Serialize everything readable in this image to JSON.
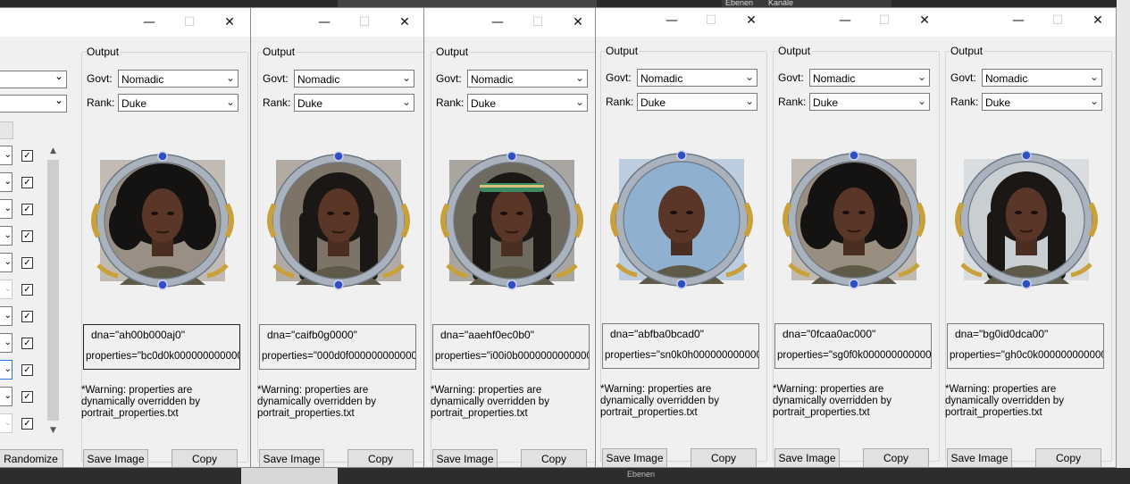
{
  "background": {
    "strip_labels": [
      "Ebenen",
      "Kanäle"
    ],
    "bottom_label": "Ebenen"
  },
  "window_controls": {
    "minimize": "—",
    "maximize": "☐",
    "close": "✕"
  },
  "left_window": {
    "randomize_label": "Randomize",
    "scroll_up": "▲",
    "scroll_down": "▼",
    "checkmark": "✓",
    "chevron": "⌄"
  },
  "icons": {
    "dropdown_arrow": "chevron-down-icon"
  },
  "colors": {
    "window_bg": "#f0f0f0",
    "titlebar_bg": "#ffffff",
    "taskbar": "#2b2b2b",
    "frame_silver": "#aab3bd",
    "frame_gold": "#c9a13a",
    "gem_blue": "#2e4fc4"
  },
  "panels": [
    {
      "group_label": "Output",
      "govt_label": "Govt:",
      "govt_value": "Nomadic",
      "rank_label": "Rank:",
      "rank_value": "Duke",
      "dna": "dna=\"ah00b000aj0\"",
      "properties": "properties=\"bc0d0k000000000000",
      "warning": "*Warning: properties are dynamically overridden by portrait_properties.txt",
      "save_label": "Save Image",
      "copy_label": "Copy",
      "portrait": {
        "hair": "afro",
        "bg": "#9a8f84"
      }
    },
    {
      "group_label": "Output",
      "govt_label": "Govt:",
      "govt_value": "Nomadic",
      "rank_label": "Rank:",
      "rank_value": "Duke",
      "dna": "dna=\"caifb0g0000\"",
      "properties": "properties=\"000d0f0000000000000",
      "warning": "*Warning: properties are dynamically overridden by portrait_properties.txt",
      "save_label": "Save Image",
      "copy_label": "Copy",
      "portrait": {
        "hair": "braids",
        "bg": "#7d7366"
      }
    },
    {
      "group_label": "Output",
      "govt_label": "Govt:",
      "govt_value": "Nomadic",
      "rank_label": "Rank:",
      "rank_value": "Duke",
      "dna": "dna=\"aaehf0ec0b0\"",
      "properties": "properties=\"i00i0b00000000000000",
      "warning": "*Warning: properties are dynamically overridden by portrait_properties.txt",
      "save_label": "Save Image",
      "copy_label": "Copy",
      "portrait": {
        "hair": "headband",
        "bg": "#6f6a60"
      }
    },
    {
      "group_label": "Output",
      "govt_label": "Govt:",
      "govt_value": "Nomadic",
      "rank_label": "Rank:",
      "rank_value": "Duke",
      "dna": "dna=\"abfba0bcad0\"",
      "properties": "properties=\"sn0k0h0000000000000",
      "warning": "*Warning: properties are dynamically overridden by portrait_properties.txt",
      "save_label": "Save Image",
      "copy_label": "Copy",
      "portrait": {
        "hair": "bald",
        "bg": "#8fb1cf"
      }
    },
    {
      "group_label": "Output",
      "govt_label": "Govt:",
      "govt_value": "Nomadic",
      "rank_label": "Rank:",
      "rank_value": "Duke",
      "dna": "dna=\"0fcaa0ac000\"",
      "properties": "properties=\"sg0f0k0000000000000",
      "warning": "*Warning: properties are dynamically overridden by portrait_properties.txt",
      "save_label": "Save Image",
      "copy_label": "Copy",
      "portrait": {
        "hair": "curly",
        "bg": "#9a8e80"
      }
    },
    {
      "group_label": "Output",
      "govt_label": "Govt:",
      "govt_value": "Nomadic",
      "rank_label": "Rank:",
      "rank_value": "Duke",
      "dna": "dna=\"bg0id0dca00\"",
      "properties": "properties=\"gh0c0k000000000000",
      "warning": "*Warning: properties are dynamically overridden by portrait_properties.txt",
      "save_label": "Save Image",
      "copy_label": "Copy",
      "portrait": {
        "hair": "longbraids",
        "bg": "#c9ced3"
      }
    }
  ]
}
